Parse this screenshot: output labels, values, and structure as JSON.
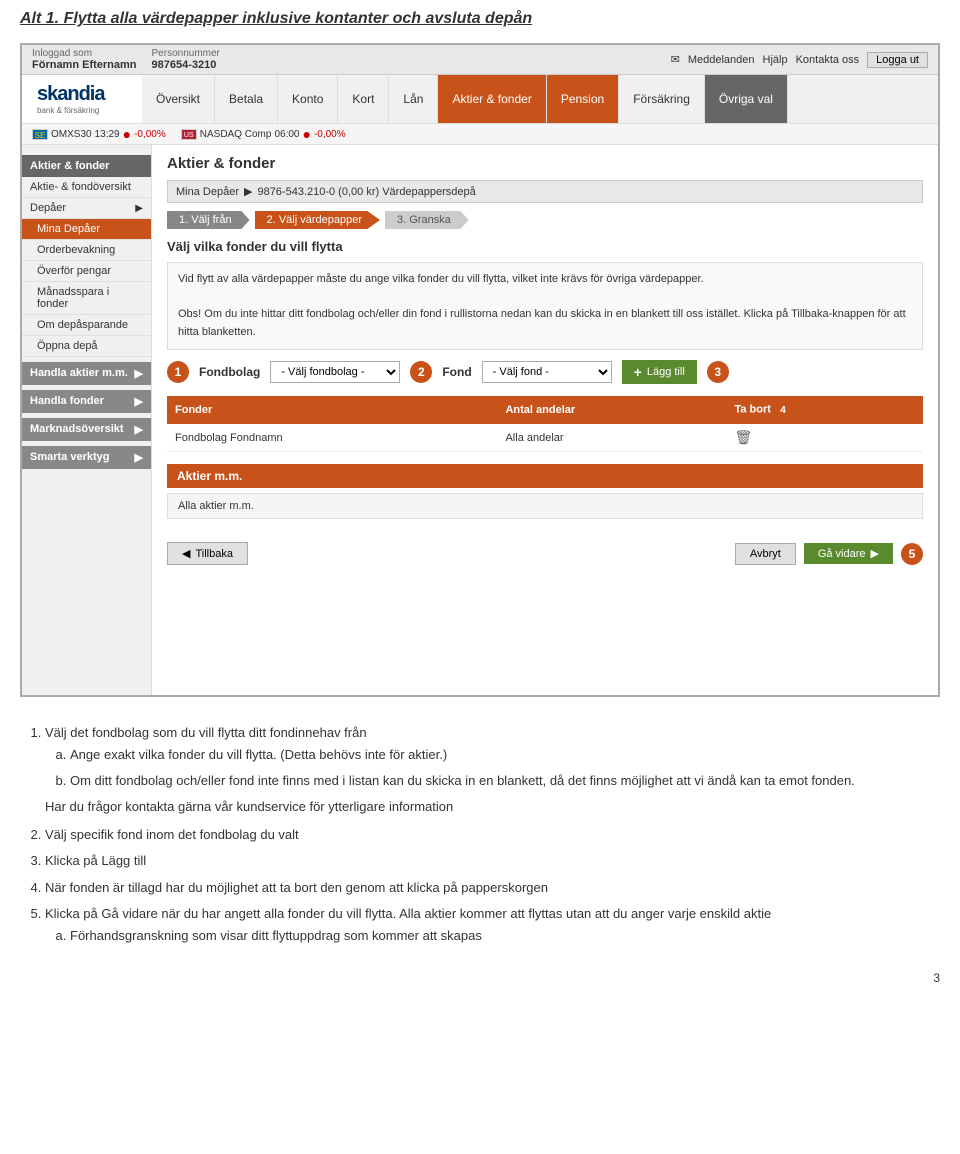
{
  "page": {
    "title": "Alt 1. Flytta alla värdepapper inklusive kontanter och avsluta depån"
  },
  "topbar": {
    "logged_in_label": "Inloggad som",
    "logged_in_name": "Förnamn Efternamn",
    "person_num_label": "Personnummer",
    "person_num": "987654-3210",
    "messages": "Meddelanden",
    "help": "Hjälp",
    "contact": "Kontakta oss",
    "logout": "Logga ut"
  },
  "nav": {
    "items": [
      {
        "label": "Översikt",
        "active": false
      },
      {
        "label": "Betala",
        "active": false
      },
      {
        "label": "Konto",
        "active": false
      },
      {
        "label": "Kort",
        "active": false
      },
      {
        "label": "Lån",
        "active": false
      },
      {
        "label": "Aktier & fonder",
        "active": true
      },
      {
        "label": "Pension",
        "active": false,
        "special": "pension"
      },
      {
        "label": "Försäkring",
        "active": false
      },
      {
        "label": "Övriga val",
        "active": false,
        "special": "ovriga"
      }
    ]
  },
  "ticker": {
    "items": [
      {
        "flag": "SE",
        "name": "OMXS30",
        "time": "13:29",
        "value": "-0,00%"
      },
      {
        "flag": "US",
        "name": "NASDAQ Comp",
        "time": "06:00",
        "value": "-0,00%"
      }
    ]
  },
  "sidebar": {
    "section1": "Aktier & fonder",
    "items1": [
      {
        "label": "Aktie- & fondöversikt",
        "active": false,
        "sub": false
      },
      {
        "label": "Depåer",
        "active": false,
        "sub": false,
        "arrow": true
      },
      {
        "label": "Mina Depåer",
        "active": true,
        "sub": true
      },
      {
        "label": "Orderbevakning",
        "active": false,
        "sub": true
      },
      {
        "label": "Överför pengar",
        "active": false,
        "sub": true
      },
      {
        "label": "Månadsspara i fonder",
        "active": false,
        "sub": true
      },
      {
        "label": "Om depåsparande",
        "active": false,
        "sub": true
      },
      {
        "label": "Öppna depå",
        "active": false,
        "sub": true
      }
    ],
    "section2": "Handla aktier m.m.",
    "section3": "Handla fonder",
    "section4": "Marknadsöversikt",
    "section5": "Smarta verktyg"
  },
  "main": {
    "title": "Aktier & fonder",
    "depot_label": "Mina Depåer",
    "depot_name": "9876-543.210-0 (0,00 kr) Värdepappersdepå",
    "steps": [
      {
        "num": "1.",
        "label": "Välj från"
      },
      {
        "num": "2.",
        "label": "Välj värdepapper"
      },
      {
        "num": "3.",
        "label": "Granska"
      }
    ],
    "section_title": "Välj vilka fonder du vill flytta",
    "info_text1": "Vid flytt av alla värdepapper måste du ange vilka fonder du vill flytta, vilket inte krävs för övriga värdepapper.",
    "info_obs": "Obs! Om du inte hittar ditt fondbolag och/eller din fond i rullistorna nedan kan du skicka in en blankett till oss istället. Klicka på Tillbaka-knappen för att hitta blanketten.",
    "fondbolag_label": "Fondbolag",
    "fond_label": "Fond",
    "fondbolag_select": "- Välj fondbolag -",
    "fond_select": "- Välj fond -",
    "lagg_till": "Lägg till",
    "table": {
      "headers": [
        "Fonder",
        "Antal andelar",
        "Ta bort"
      ],
      "rows": [
        {
          "fonder": "Fondbolag Fondnamn",
          "antal": "Alla andelar"
        }
      ]
    },
    "aktier_header": "Aktier m.m.",
    "aktier_value": "Alla aktier m.m.",
    "tillbaka": "Tillbaka",
    "avbryt": "Avbryt",
    "ga_vidare": "Gå vidare"
  },
  "body_text": {
    "intro": "1)  Välj det fondbolag som du vill flytta ditt fondinnehav från",
    "a": "a.  Ange exakt vilka fonder du vill flytta. (Detta behövs inte för aktier.)",
    "b": "b.  Om ditt fondbolag och/eller fond inte finns med i listan kan du skicka in en blankett, då det finns möjlighet att vi ändå kan ta emot fonden.",
    "c": "Har du frågor kontakta gärna vår kundservice för ytterligare information",
    "p2": "2)  Välj specifik fond inom det fondbolag du valt",
    "p3": "3)  Klicka på Lägg till",
    "p4": "4)  När fonden är tillagd har du möjlighet att ta bort den genom att klicka på papperskorgen",
    "p5": "5)  Klicka på Gå vidare när du har angett alla fonder du vill flytta. Alla aktier kommer att flyttas utan att du anger varje enskild aktie",
    "p5a": "a.  Förhandsgranskning som visar ditt flyttuppdrag som kommer att skapas"
  },
  "page_number": "3"
}
